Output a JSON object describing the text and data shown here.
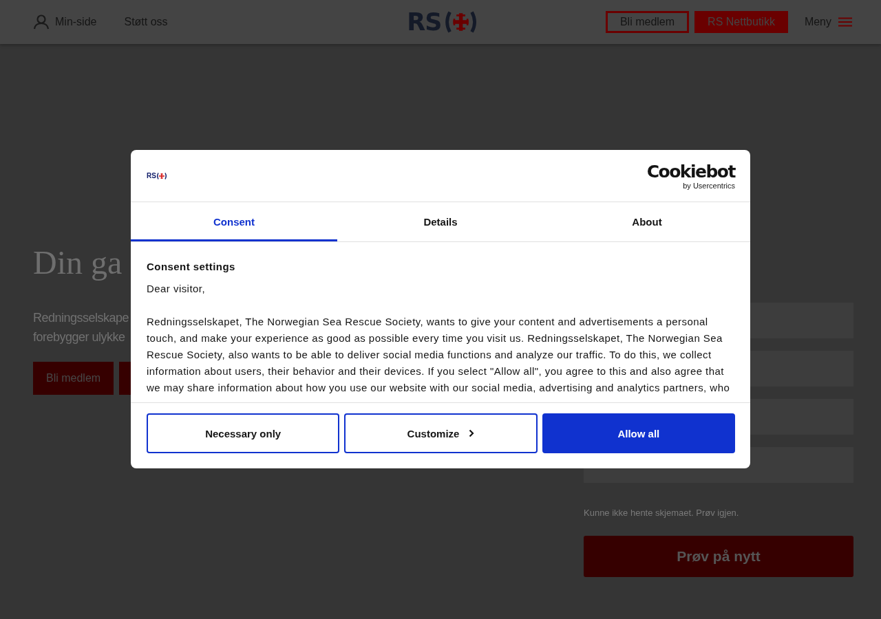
{
  "header": {
    "account_link": "Min-side",
    "support_link": "Støtt oss",
    "logo_text": "RS",
    "buttons": [
      {
        "label": "Bli medlem",
        "kind": "outline"
      },
      {
        "label": "RS Nettbutikk",
        "kind": "filled"
      }
    ],
    "menu_label": "Meny"
  },
  "hero": {
    "heading": "Din ga",
    "lines": [
      "Redningsselskape",
      "forebygger ulykke"
    ],
    "buttons": [
      {
        "kind": "labeled",
        "label": "Bli medlem"
      },
      {
        "kind": "covered"
      }
    ]
  },
  "form": {
    "fields": [
      {
        "kind": "text"
      },
      {
        "kind": "text"
      },
      {
        "kind": "text"
      },
      {
        "kind": "spaced"
      }
    ],
    "error": "Kunne ikke hente skjemaet. Prøv igjen.",
    "retry_button": "Prøv på nytt"
  },
  "dialog": {
    "logo_text": "RS",
    "brand": {
      "name": "Cookiebot",
      "tagline": "by Usercentrics"
    },
    "tabs": [
      {
        "label": "Consent",
        "selected": true
      },
      {
        "label": "Details",
        "selected": false
      },
      {
        "label": "About",
        "selected": false
      }
    ],
    "heading": "Consent settings",
    "greeting": "Dear visitor,",
    "body": "Redningsselskapet, The Norwegian Sea Rescue Society, wants to give your content and advertisements a personal touch, and make your experience as good as possible every time you visit us. Redningsselskapet, The Norwegian Sea Rescue Society, also wants to be able to deliver social media functions and analyze our traffic. To do this, we collect information about users, their behavior and their devices. If you select \"Allow all\", you agree to this and also agree that we may share information about how you use our website with our social media, advertising and analytics partners, who",
    "buttons": [
      {
        "label": "Necessary only",
        "kind": "outline"
      },
      {
        "label": "Customize",
        "kind": "chevron"
      },
      {
        "label": "Allow all",
        "kind": "primary"
      }
    ]
  }
}
